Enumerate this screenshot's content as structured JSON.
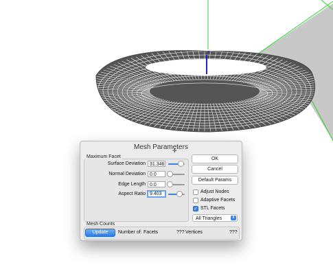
{
  "dialog": {
    "title": "Mesh Parameters",
    "max_facet": {
      "group_title": "Maximum Facet",
      "rows": [
        {
          "label": "Surface Deviation",
          "value": "31.346",
          "slider": 0.93
        },
        {
          "label": "Normal Deviation",
          "value": "0.0",
          "slider": 0.0
        },
        {
          "label": "Edge Length",
          "value": "0.0",
          "slider": 0.0
        },
        {
          "label": "Aspect Ratio",
          "value": "9.403",
          "slider": 0.84
        }
      ]
    },
    "buttons": {
      "ok": "OK",
      "cancel": "Cancel",
      "default_params": "Default Params"
    },
    "options": {
      "adjust_nodes": {
        "label": "Adjust Nodes",
        "checked": false
      },
      "adaptive_facets": {
        "label": "Adaptive Facets",
        "checked": false
      },
      "stl_facets": {
        "label": "STL Facets",
        "checked": true
      }
    },
    "triangles_select": "All Triangles",
    "mesh_counts": {
      "group_title": "Mesh Counts",
      "update_label": "Update",
      "number_of": "Number of:",
      "facets_label": "Facets",
      "facets_value": "???",
      "vertices_label": "Vertices",
      "vertices_value": "???"
    }
  },
  "viewport": {
    "axis_label": "z"
  },
  "colors": {
    "accent": "#3b82e0",
    "plane": "#c8c8c8",
    "edges": "#2fd12f",
    "axis": "#2222cc"
  }
}
